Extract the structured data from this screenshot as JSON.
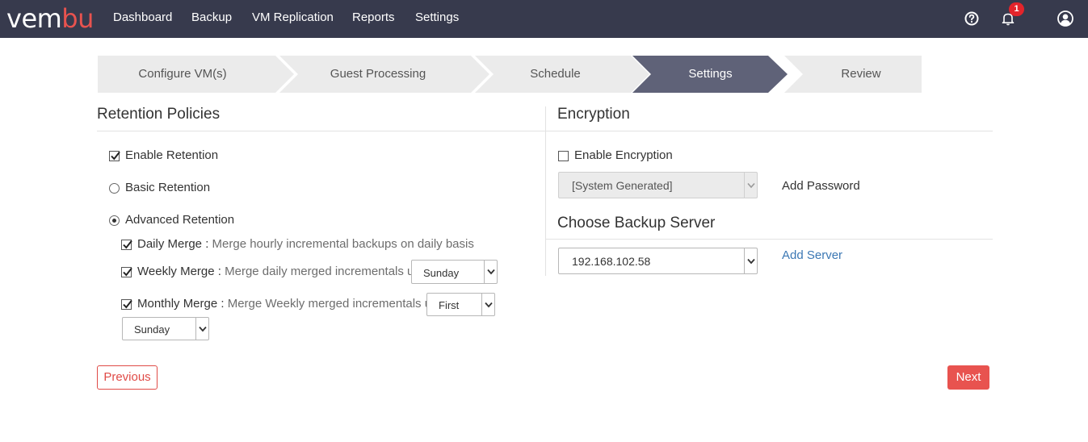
{
  "app": {
    "logo_main": "vem",
    "logo_accent": "bu",
    "logo_tail": ""
  },
  "nav": {
    "items": [
      {
        "label": "Dashboard"
      },
      {
        "label": "Backup"
      },
      {
        "label": "VM Replication"
      },
      {
        "label": "Reports"
      },
      {
        "label": "Settings"
      }
    ],
    "icons": [
      "help-icon",
      "bell-icon",
      "user-icon"
    ],
    "notification_count": "1"
  },
  "wizard": {
    "steps": [
      {
        "label": "Configure VM(s)",
        "active": false
      },
      {
        "label": "Guest Processing",
        "active": false
      },
      {
        "label": "Schedule",
        "active": false
      },
      {
        "label": "Settings",
        "active": true
      },
      {
        "label": "Review",
        "active": false
      }
    ]
  },
  "retention": {
    "title": "Retention Policies",
    "enable_label": "Enable Retention",
    "enable_checked": true,
    "basic_label": "Basic Retention",
    "advanced_label": "Advanced Retention",
    "selected": "advanced",
    "daily": {
      "name": "Daily Merge :",
      "desc": " Merge hourly incremental backups on daily basis",
      "checked": true
    },
    "weekly": {
      "name": "Weekly Merge :",
      "desc": " Merge daily merged incrementals upto",
      "checked": true,
      "day": "Sunday"
    },
    "monthly": {
      "name": "Monthly Merge :",
      "desc": " Merge Weekly merged incrementals upto",
      "checked": true,
      "week": "First",
      "day": "Sunday"
    }
  },
  "encryption": {
    "title": "Encryption",
    "enable_label": "Enable Encryption",
    "enable_checked": false,
    "password_mode": "[System Generated]",
    "add_password_label": "Add Password"
  },
  "backup_server": {
    "title": "Choose Backup Server",
    "selected": "192.168.102.58",
    "add_server_label": "Add Server"
  },
  "footer": {
    "previous_label": "Previous",
    "next_label": "Next"
  },
  "colors": {
    "topbar": "#373a4d",
    "accent": "#e8534f",
    "step_inactive": "#ebebeb",
    "step_active": "#5f6278",
    "link": "#3c78b4"
  }
}
